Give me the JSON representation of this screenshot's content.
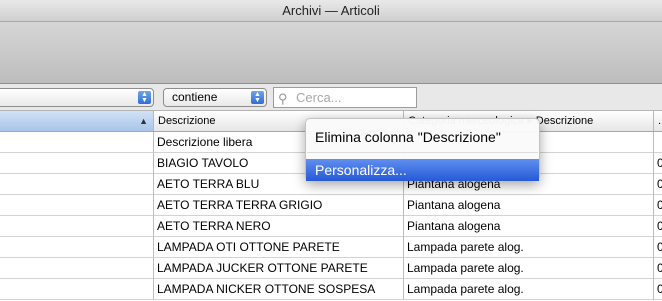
{
  "window": {
    "title": "Archivi — Articoli"
  },
  "filter": {
    "field_select_value": "",
    "operator_select_value": "contiene",
    "search_placeholder": "Cerca..."
  },
  "table": {
    "columns": [
      {
        "label": ""
      },
      {
        "label": "Descrizione"
      },
      {
        "label": "Categoria merceologica ▸ Descrizione"
      },
      {
        "label": "."
      }
    ],
    "rows": [
      {
        "c2": "Descrizione libera",
        "c3": "",
        "c4": ""
      },
      {
        "c2": "BIAGIO TAVOLO",
        "c3": "",
        "c4": "0"
      },
      {
        "c2": "AETO TERRA BLU",
        "c3": "Piantana alogena",
        "c4": "0"
      },
      {
        "c2": "AETO TERRA TERRA GRIGIO",
        "c3": "Piantana alogena",
        "c4": "0"
      },
      {
        "c2": "AETO TERRA NERO",
        "c3": "Piantana alogena",
        "c4": "0"
      },
      {
        "c2": "LAMPADA OTI OTTONE PARETE",
        "c3": "Lampada parete alog.",
        "c4": "0"
      },
      {
        "c2": "LAMPADA JUCKER OTTONE PARETE",
        "c3": "Lampada parete alog.",
        "c4": "0"
      },
      {
        "c2": "LAMPADA NICKER OTTONE SOSPESA",
        "c3": "Lampada parete alog.",
        "c4": "0"
      }
    ]
  },
  "context_menu": {
    "items": [
      {
        "label": "Elimina colonna \"Descrizione\""
      },
      {
        "label": "Personalizza..."
      }
    ]
  },
  "colors": {
    "highlight": "#2f62dd",
    "selected_header": "#b9d0ee"
  }
}
